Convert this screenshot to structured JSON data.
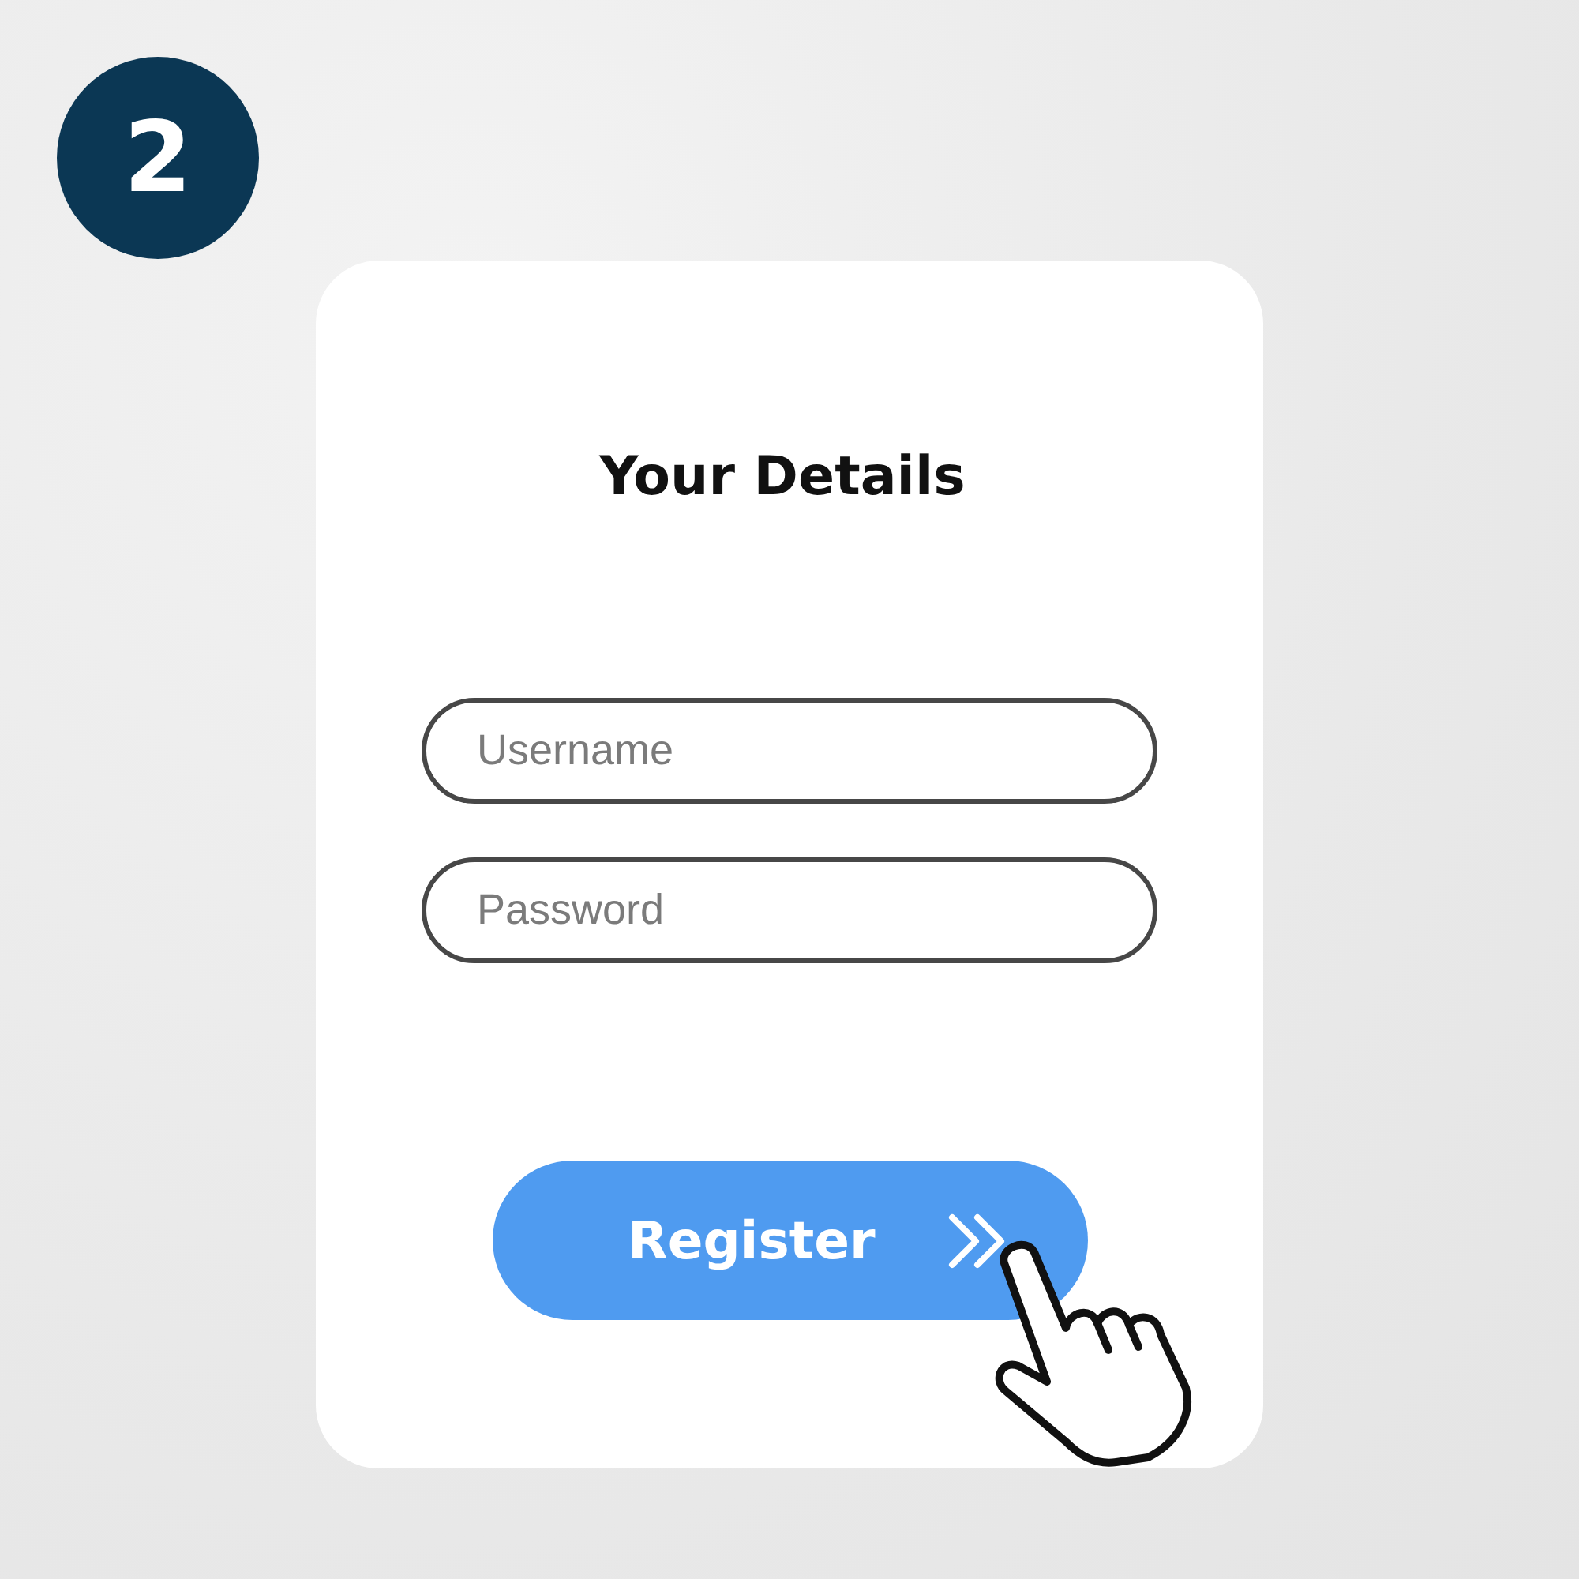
{
  "step_badge": {
    "number": "2"
  },
  "form": {
    "title": "Your Details",
    "fields": [
      {
        "placeholder": "Username"
      },
      {
        "placeholder": "Password"
      }
    ],
    "submit_button": {
      "label": "Register"
    }
  }
}
